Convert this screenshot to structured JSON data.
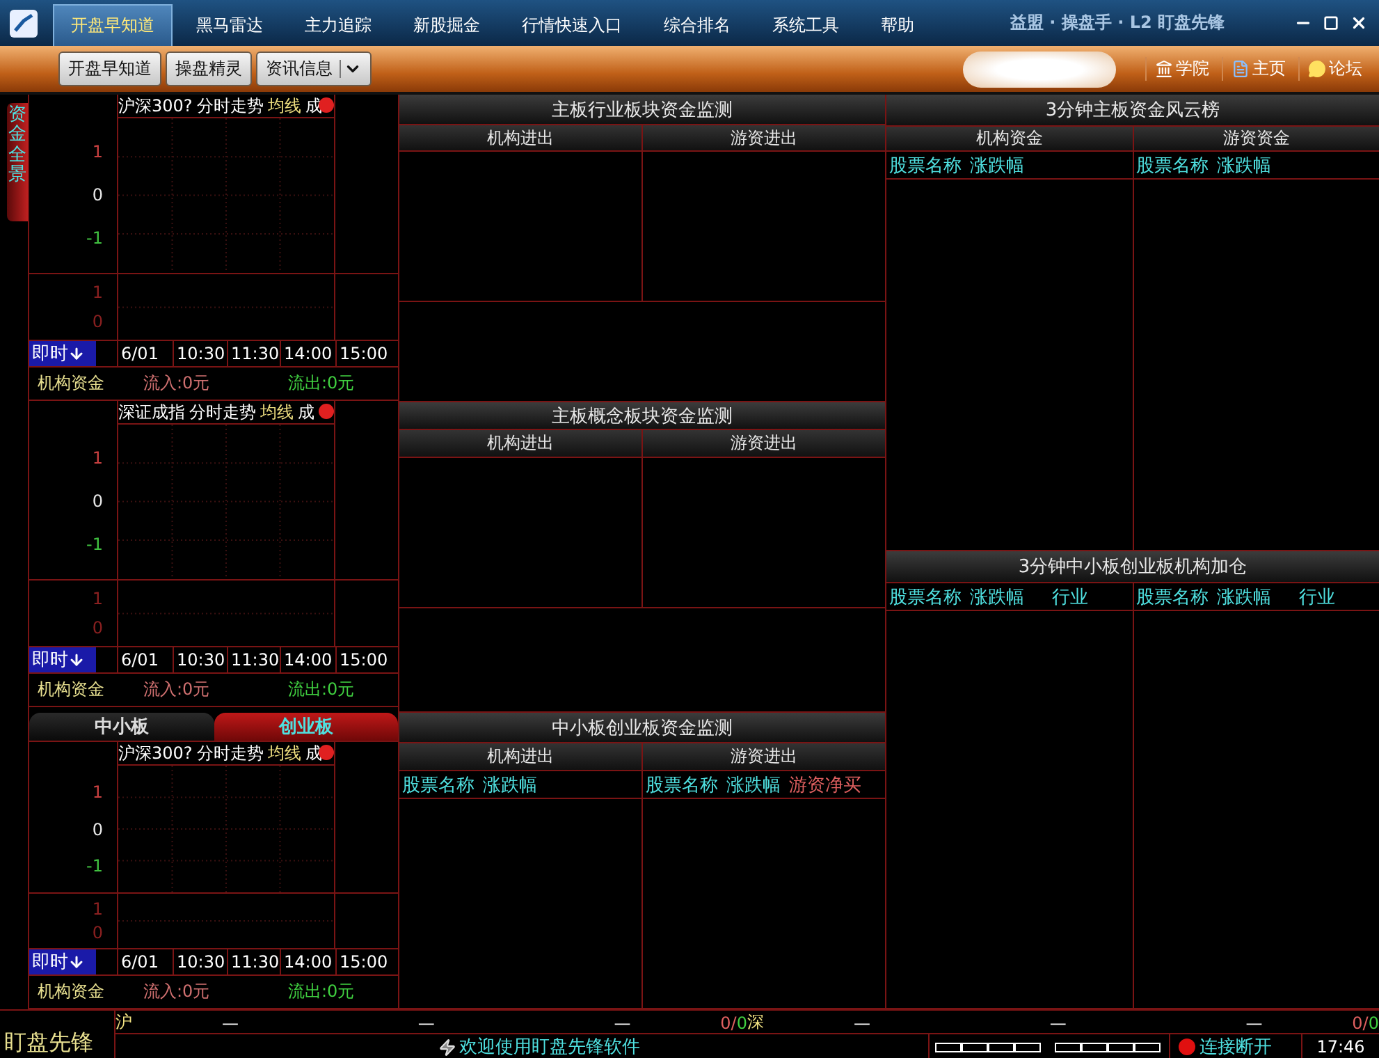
{
  "title_bar": {
    "menu": [
      {
        "label": "开盘早知道",
        "selected": true
      },
      {
        "label": "黑马雷达",
        "selected": false
      },
      {
        "label": "主力追踪",
        "selected": false
      },
      {
        "label": "新股掘金",
        "selected": false
      },
      {
        "label": "行情快速入口",
        "selected": false
      },
      {
        "label": "综合排名",
        "selected": false
      },
      {
        "label": "系统工具",
        "selected": false
      },
      {
        "label": "帮助",
        "selected": false
      }
    ],
    "app_title": "益盟 · 操盘手 · L2 盯盘先锋"
  },
  "toolbar": {
    "buttons": [
      {
        "label": "开盘早知道",
        "dropdown": false
      },
      {
        "label": "操盘精灵",
        "dropdown": false
      },
      {
        "label": "资讯信息",
        "dropdown": true
      }
    ],
    "links": [
      {
        "label": "学院",
        "kind": "academy"
      },
      {
        "label": "主页",
        "kind": "home"
      },
      {
        "label": "论坛",
        "kind": "forum"
      }
    ]
  },
  "left_panel": {
    "side_tab": "资金全景",
    "charts": [
      {
        "title": "沪深300?",
        "labels": [
          "分时走势",
          "均线",
          "成"
        ],
        "y_ticks": [
          {
            "label": "1",
            "kind": "up"
          },
          {
            "label": "0",
            "kind": "flat"
          },
          {
            "label": "-1",
            "kind": "down"
          }
        ],
        "volume_ticks": [
          "1",
          "0"
        ],
        "time_button": "即时",
        "times": [
          "6/01",
          "10:30",
          "11:30",
          "14:00",
          "15:00"
        ],
        "info": {
          "label": "机构资金",
          "inflow": "流入:0元",
          "outflow": "流出:0元"
        }
      },
      {
        "title": "深证成指",
        "labels": [
          "分时走势",
          "均线",
          "成"
        ],
        "y_ticks": [
          {
            "label": "1",
            "kind": "up"
          },
          {
            "label": "0",
            "kind": "flat"
          },
          {
            "label": "-1",
            "kind": "down"
          }
        ],
        "volume_ticks": [
          "1",
          "0"
        ],
        "time_button": "即时",
        "times": [
          "6/01",
          "10:30",
          "11:30",
          "14:00",
          "15:00"
        ],
        "info": {
          "label": "机构资金",
          "inflow": "流入:0元",
          "outflow": "流出:0元"
        }
      }
    ],
    "board_tabs": [
      {
        "label": "中小板",
        "selected": false
      },
      {
        "label": "创业板",
        "selected": true
      }
    ],
    "board_chart": {
      "title": "沪深300?",
      "labels": [
        "分时走势",
        "均线",
        "成"
      ],
      "y_ticks": [
        {
          "label": "1",
          "kind": "up"
        },
        {
          "label": "0",
          "kind": "flat"
        },
        {
          "label": "-1",
          "kind": "down"
        }
      ],
      "volume_ticks": [
        "1",
        "0"
      ],
      "time_button": "即时",
      "times": [
        "6/01",
        "10:30",
        "11:30",
        "14:00",
        "15:00"
      ],
      "info": {
        "label": "机构资金",
        "inflow": "流入:0元",
        "outflow": "流出:0元"
      }
    }
  },
  "monitors": [
    {
      "title": "主板行业板块资金监测",
      "columns": [
        "机构进出",
        "游资进出"
      ]
    },
    {
      "title": "主板概念板块资金监测",
      "columns": [
        "机构进出",
        "游资进出"
      ]
    },
    {
      "title": "中小板创业板资金监测",
      "columns": [
        "机构进出",
        "游资进出"
      ],
      "fields": [
        [
          {
            "label": "股票名称",
            "kind": "col"
          },
          {
            "label": "涨跌幅",
            "kind": "col"
          }
        ],
        [
          {
            "label": "股票名称",
            "kind": "col"
          },
          {
            "label": "涨跌幅",
            "kind": "col"
          },
          {
            "label": "游资净买",
            "kind": "net"
          }
        ]
      ]
    }
  ],
  "rankings": [
    {
      "title": "3分钟主板资金风云榜",
      "columns": [
        "机构资金",
        "游资资金"
      ],
      "fields": [
        [
          {
            "label": "股票名称",
            "kind": "col"
          },
          {
            "label": "涨跌幅",
            "kind": "col"
          }
        ],
        [
          {
            "label": "股票名称",
            "kind": "col"
          },
          {
            "label": "涨跌幅",
            "kind": "col"
          }
        ]
      ]
    },
    {
      "title": "3分钟中小板创业板机构加仓",
      "fields": [
        [
          {
            "label": "股票名称",
            "kind": "col"
          },
          {
            "label": "涨跌幅",
            "kind": "col"
          },
          {
            "label": "行业",
            "kind": "sector"
          }
        ],
        [
          {
            "label": "股票名称",
            "kind": "col"
          },
          {
            "label": "涨跌幅",
            "kind": "col"
          },
          {
            "label": "行业",
            "kind": "sector"
          }
        ]
      ]
    }
  ],
  "status_bar": {
    "logo": "盯盘先锋",
    "markets": [
      {
        "label": "沪",
        "values": [
          "—",
          "—",
          "—"
        ],
        "rise": "0/",
        "fall": "0"
      },
      {
        "label": "深",
        "values": [
          "—",
          "—",
          "—"
        ],
        "rise": "0/",
        "fall": "0"
      }
    ],
    "message": "欢迎使用盯盘先锋软件",
    "connection": {
      "label": "连接断开",
      "connected": false
    },
    "time": "17:46"
  }
}
